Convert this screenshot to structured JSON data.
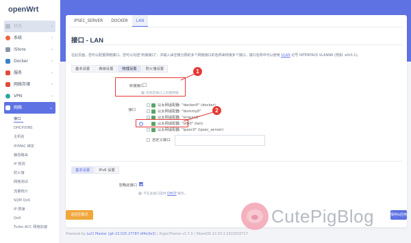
{
  "brand": {
    "name": "openWrt"
  },
  "sidebar": {
    "items": [
      {
        "label": "状态",
        "icon": "status-icon",
        "color": "#b7bdcc"
      },
      {
        "label": "系统",
        "icon": "gear-icon",
        "color": "#f0623e"
      },
      {
        "label": "iStore",
        "icon": "store-icon",
        "color": "#8c94a8"
      },
      {
        "label": "Docker",
        "icon": "docker-icon",
        "color": "#3b82c4"
      },
      {
        "label": "服务",
        "icon": "service-icon",
        "color": "#e04a3a"
      },
      {
        "label": "网络存储",
        "icon": "storage-icon",
        "color": "#e04a3a"
      },
      {
        "label": "VPN",
        "icon": "vpn-icon",
        "color": "#2aa6a0"
      },
      {
        "label": "网络",
        "icon": "network-icon",
        "color": "#ffffff"
      }
    ],
    "submenu": [
      "接口",
      "DHCP/DNS",
      "主机名",
      "IP/MAC 绑定",
      "静态路由",
      "IP 规则",
      "防火墙",
      "网络测试",
      "流量统计",
      "SQM QoS",
      "IP 限速",
      "QoS",
      "Turbo ACC 网络加速"
    ]
  },
  "top_tabs": [
    "IPSEC_SERVER",
    "DOCKER",
    "LAN"
  ],
  "page": {
    "title": "接口 - LAN",
    "description_pre": "在此页面，您可以配置网络接口。您可以勾选\"桥接接口\"，并输入由空格分隔的多个网络接口的名称来桥接多个接口。接口名称中可以使用",
    "description_link": "VLAN",
    "description_post": "记号 INTERFACE.VLANNR (例如: eth0.1)。"
  },
  "subtabs": [
    "基本设置",
    "高级设置",
    "物理设置",
    "防火墙设置"
  ],
  "bridge": {
    "label": "桥接接口",
    "hint": "在指定接口上创建桥接"
  },
  "interface": {
    "label": "接口",
    "options": [
      "以太网适配器: \"docker0\" (docker)",
      "以太网适配器: \"dummy0\"",
      "以太网适配器: \"erspan0\"",
      "以太网适配器: \"eth0\" (lan)",
      "以太网适配器: \"ipsec0\" (ipsec_server)"
    ],
    "custom_label": "自定义接口:"
  },
  "callouts": [
    "1",
    "2"
  ],
  "bottom_tabs": [
    "基本设置",
    "IPv6 设置"
  ],
  "dhcp": {
    "ignore_label": "忽略此接口",
    "hint_pre": "不在此接口提供",
    "hint_link": "DHCP",
    "hint_post": "服务。"
  },
  "buttons": {
    "back": "返回至概况",
    "apply": "保存&应用"
  },
  "footer": {
    "pre": "Powered by",
    "link": "LuCI Master (git-23.025.27787-df4e3e3)",
    "post": "/ ArgonTheme v1.7.3 / iStoreOS 22.03.3 2023010717"
  },
  "watermark": "CutePigBlog"
}
